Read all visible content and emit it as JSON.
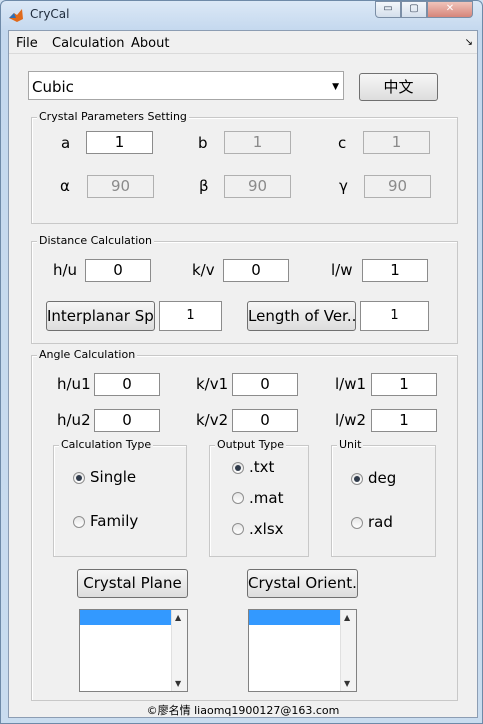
{
  "window": {
    "title": "CryCal",
    "min_glyph": "▭",
    "max_glyph": "▢",
    "close_glyph": "✕"
  },
  "menu": {
    "file": "File",
    "calculation": "Calculation",
    "about": "About",
    "overflow_glyph": "↘"
  },
  "lattice": {
    "selected": "Cubic",
    "dropdown_glyph": "▼"
  },
  "language_button": "中文",
  "crystal_params": {
    "title": "Crystal Parameters Setting",
    "a_label": "a",
    "a": "1",
    "b_label": "b",
    "b": "1",
    "c_label": "c",
    "c": "1",
    "alpha_label": "α",
    "alpha": "90",
    "beta_label": "β",
    "beta": "90",
    "gamma_label": "γ",
    "gamma": "90"
  },
  "distance": {
    "title": "Distance Calculation",
    "h_label": "h/u",
    "h": "0",
    "k_label": "k/v",
    "k": "0",
    "l_label": "l/w",
    "l": "1",
    "interplanar_button": "Interplanar Sp...",
    "interplanar_result": "1",
    "length_button": "Length of Ver...",
    "length_result": "1"
  },
  "angle": {
    "title": "Angle Calculation",
    "h1_label": "h/u1",
    "h1": "0",
    "k1_label": "k/v1",
    "k1": "0",
    "l1_label": "l/w1",
    "l1": "1",
    "h2_label": "h/u2",
    "h2": "0",
    "k2_label": "k/v2",
    "k2": "0",
    "l2_label": "l/w2",
    "l2": "1",
    "calc_type": {
      "title": "Calculation Type",
      "single": "Single",
      "family": "Family",
      "selected": "Single"
    },
    "output_type": {
      "title": "Output Type",
      "txt": ".txt",
      "mat": ".mat",
      "xlsx": ".xlsx",
      "selected": ".txt"
    },
    "unit": {
      "title": "Unit",
      "deg": "deg",
      "rad": "rad",
      "selected": "deg"
    },
    "plane_button": "Crystal Plane",
    "orient_button": "Crystal Orient..."
  },
  "scroll": {
    "up_glyph": "▲",
    "down_glyph": "▼"
  },
  "footer": "©廖名情  liaomq1900127@163.com"
}
